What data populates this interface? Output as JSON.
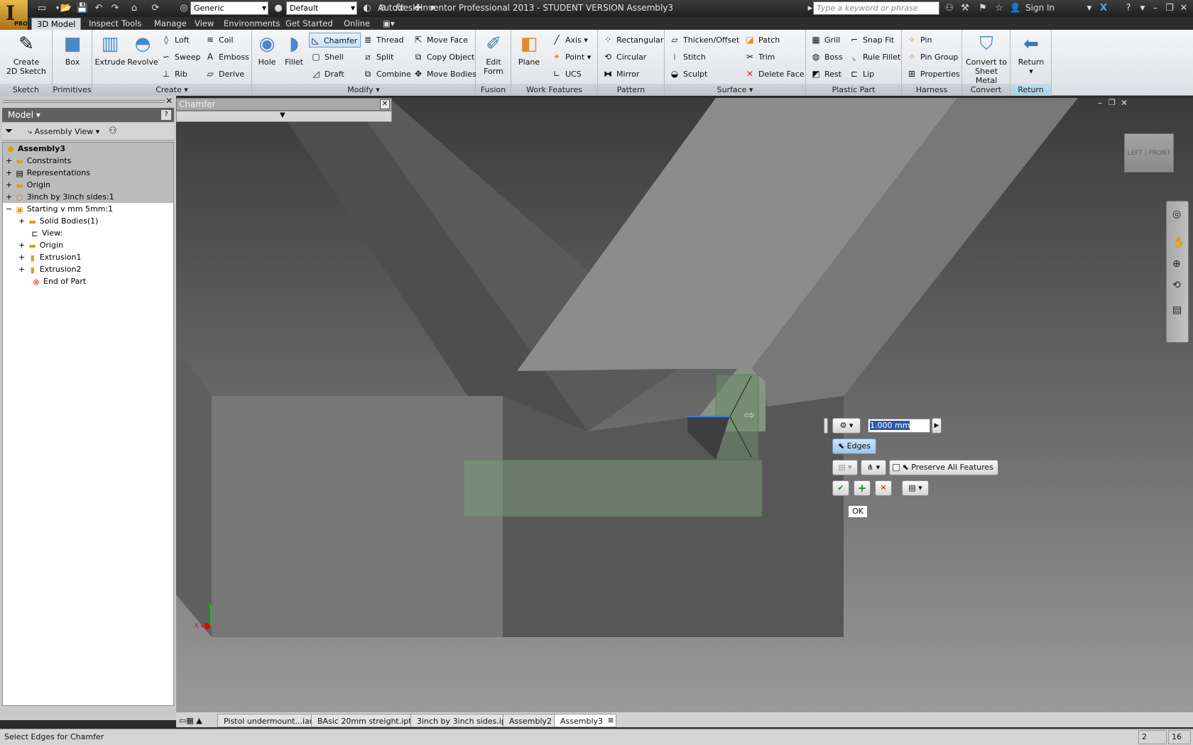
{
  "app": {
    "title": "Autodesk Inventor Professional 2013 - STUDENT VERSION   Assembly3",
    "app_letter": "I",
    "edition": "PRO",
    "search_placeholder": "Type a keyword or phrase",
    "sign_in": "Sign In",
    "material": "Generic",
    "appearance": "Default",
    "fx": "fx"
  },
  "menu": [
    "3D Model",
    "Inspect",
    "Tools",
    "Manage",
    "View",
    "Environments",
    "Get Started",
    "Online"
  ],
  "ribbon": {
    "sketch": {
      "label": "Sketch",
      "create": "Create",
      "sketch2d": "2D Sketch"
    },
    "primitives": {
      "label": "Primitives",
      "box": "Box"
    },
    "create": {
      "label": "Create",
      "extrude": "Extrude",
      "revolve": "Revolve",
      "loft": "Loft",
      "sweep": "Sweep",
      "rib": "Rib",
      "coil": "Coil",
      "emboss": "Emboss",
      "derive": "Derive"
    },
    "modify": {
      "label": "Modify",
      "hole": "Hole",
      "fillet": "Fillet",
      "chamfer": "Chamfer",
      "shell": "Shell",
      "draft": "Draft",
      "thread": "Thread",
      "split": "Split",
      "combine": "Combine",
      "move_face": "Move Face",
      "copy_object": "Copy Object",
      "move_bodies": "Move Bodies"
    },
    "fusion": {
      "label": "Fusion",
      "edit": "Edit",
      "form": "Form"
    },
    "work": {
      "label": "Work Features",
      "plane": "Plane",
      "axis": "Axis",
      "point": "Point",
      "ucs": "UCS"
    },
    "pattern": {
      "label": "Pattern",
      "rectangular": "Rectangular",
      "circular": "Circular",
      "mirror": "Mirror"
    },
    "surface": {
      "label": "Surface",
      "thicken": "Thicken/Offset",
      "stitch": "Stitch",
      "sculpt": "Sculpt",
      "patch": "Patch",
      "trim": "Trim",
      "delete_face": "Delete Face"
    },
    "plastic": {
      "label": "Plastic Part",
      "grill": "Grill",
      "boss": "Boss",
      "rest": "Rest",
      "snap_fit": "Snap Fit",
      "rule_fillet": "Rule Fillet",
      "lip": "Lip"
    },
    "harness": {
      "label": "Harness",
      "pin": "Pin",
      "pin_group": "Pin Group",
      "properties": "Properties"
    },
    "convert": {
      "label": "Convert",
      "btn1": "Convert to",
      "btn2": "Sheet Metal"
    },
    "return": {
      "label": "Return",
      "btn": "Return"
    }
  },
  "browser": {
    "title": "Model",
    "view": "Assembly View",
    "nodes": [
      {
        "label": "Assembly3",
        "bold": true
      },
      {
        "label": "Constraints"
      },
      {
        "label": "Representations"
      },
      {
        "label": "Origin"
      },
      {
        "label": "3inch by 3inch sides:1"
      },
      {
        "label": "Starting v mm 5mm:1"
      },
      {
        "label": "Solid Bodies(1)"
      },
      {
        "label": "View:"
      },
      {
        "label": "Origin"
      },
      {
        "label": "Extrusion1"
      },
      {
        "label": "Extrusion2"
      },
      {
        "label": "End of Part"
      }
    ]
  },
  "chamfer_panel": {
    "title": "Chamfer"
  },
  "minitoolbar": {
    "distance": "1.000 mm",
    "edges": "Edges",
    "preserve": "Preserve All Features",
    "ok": "OK"
  },
  "viewcube": {
    "left": "LEFT",
    "front": "FRONT"
  },
  "doc_tabs": [
    "Pistol undermount...iam",
    "BAsic 20mm streight.ipt",
    "3inch by 3inch sides.ipt",
    "Assembly2",
    "Assembly3"
  ],
  "status": {
    "text": "Select Edges for Chamfer",
    "n1": "2",
    "n2": "16"
  },
  "axes": {
    "x": "X",
    "y": "Y"
  }
}
